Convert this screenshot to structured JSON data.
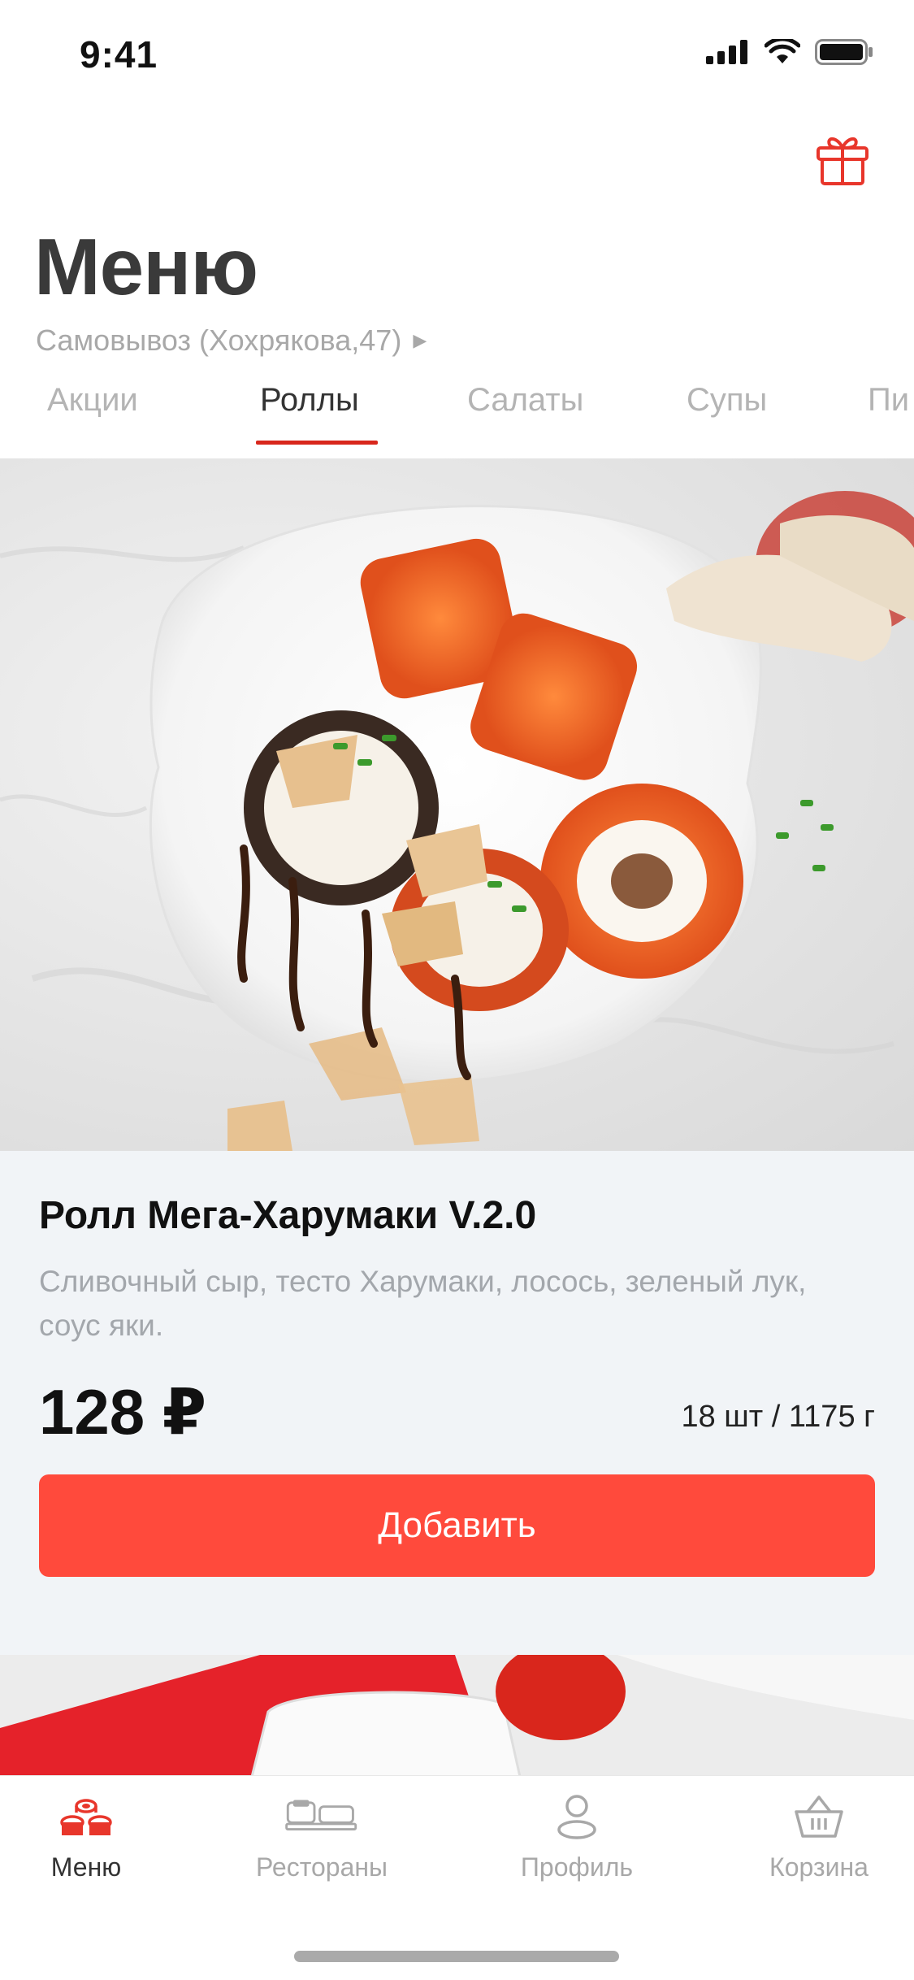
{
  "status_bar": {
    "time": "9:41"
  },
  "header": {
    "title": "Меню",
    "pickup_label": "Самовывоз (Хохрякова,47)",
    "gift_icon": "gift-icon"
  },
  "category_tabs": [
    {
      "label": "Акции",
      "active": false
    },
    {
      "label": "Роллы",
      "active": true
    },
    {
      "label": "Салаты",
      "active": false
    },
    {
      "label": "Супы",
      "active": false
    },
    {
      "label": "Пи",
      "active": false
    }
  ],
  "product": {
    "title": "Ролл Мега-Харумаки V.2.0",
    "description": "Сливочный сыр, тесто Харумаки, лосось, зеленый лук, соус яки.",
    "price": "128 ₽",
    "weight": "18 шт / 1175 г",
    "add_label": "Добавить"
  },
  "tabbar": [
    {
      "label": "Меню",
      "icon": "sushi-icon",
      "active": true
    },
    {
      "label": "Рестораны",
      "icon": "restaurants-icon",
      "active": false
    },
    {
      "label": "Профиль",
      "icon": "profile-icon",
      "active": false
    },
    {
      "label": "Корзина",
      "icon": "basket-icon",
      "active": false
    }
  ],
  "colors": {
    "accent": "#ff4a3c",
    "tab_underline": "#d8271c",
    "card_bg": "#f1f4f7"
  }
}
